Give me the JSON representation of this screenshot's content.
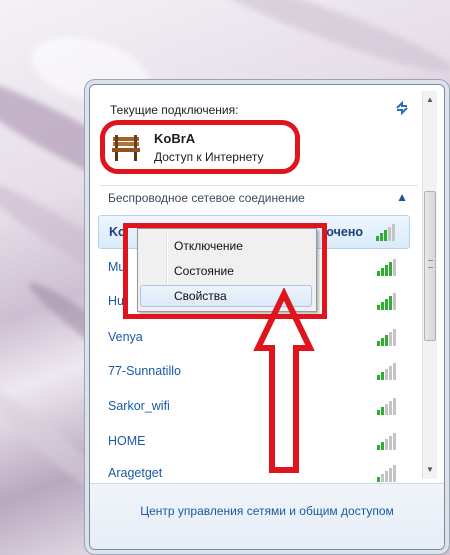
{
  "current": {
    "label": "Текущие подключения:",
    "name": "KoBrA",
    "status": "Доступ к Интернету"
  },
  "wireless": {
    "title": "Беспроводное сетевое соединение",
    "networks": [
      {
        "name": "Ko",
        "status": "очено",
        "selected": true
      },
      {
        "name": "Mu"
      },
      {
        "name": "Hu"
      },
      {
        "name": "Venya"
      },
      {
        "name": "77-Sunnatillo"
      },
      {
        "name": "Sarkor_wifi"
      },
      {
        "name": "HOME"
      },
      {
        "name": "Aragetget"
      }
    ]
  },
  "context_menu": {
    "items": [
      "Отключение",
      "Состояние",
      "Свойства"
    ],
    "hovered": "Свойства"
  },
  "footer": {
    "link": "Центр управления сетями и общим доступом"
  },
  "colors": {
    "annotation": "#e0141c",
    "link": "#1a5aa6",
    "signal": "#2fae2f"
  }
}
